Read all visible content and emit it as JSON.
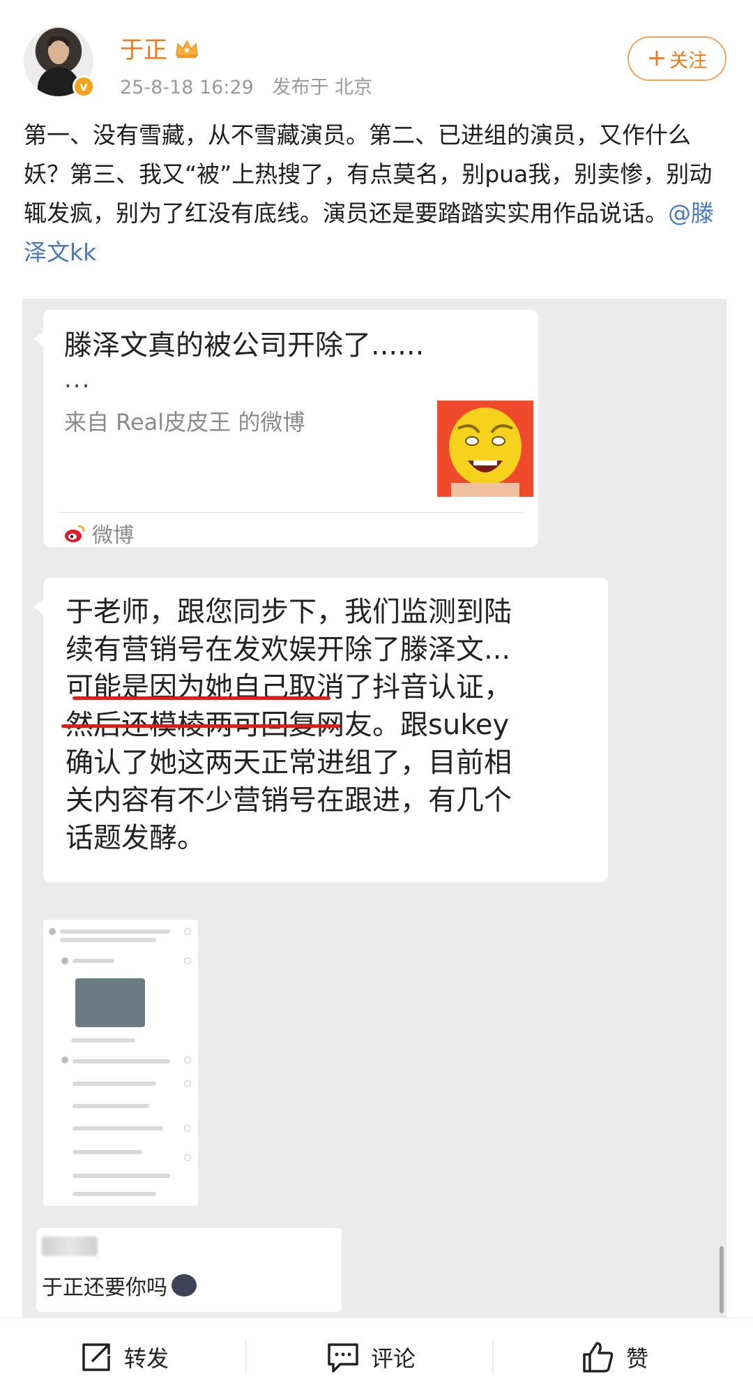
{
  "post": {
    "username": "于正",
    "time": "25-8-18 16:29",
    "location": "发布于 北京",
    "follow_label": "关注",
    "follow_plus": "+",
    "verified_badge": "v",
    "text": "第一、没有雪藏，从不雪藏演员。第二、已进组的演员，又作什么妖？第三、我又“被”上热搜了，有点莫名，别pua我，别卖惨，别动辄发疯，别为了红没有底线。演员还是要踏踏实实用作品说话。",
    "mention": "@滕泽文kk"
  },
  "screenshot": {
    "bubble1": {
      "title": "滕泽文真的被公司开除了......",
      "title_cont": "...",
      "source": "来自 Real皮皮王 的微博",
      "footer": "微博"
    },
    "bubble2": {
      "lines": [
        "于老师，跟您同步下，我们监测到陆",
        "续有营销号在发欢娱开除了滕泽文...",
        "可能是因为她自己取消了抖音认证，",
        "然后还模棱两可回复网友。跟sukey",
        "确认了她这两天正常进组了，目前相",
        "关内容有不少营销号在跟进，有几个",
        "话题发酵。"
      ]
    },
    "bubble3": {
      "text": "于正还要你吗"
    }
  },
  "toolbar": {
    "repost": "转发",
    "comment": "评论",
    "like": "赞"
  },
  "colors": {
    "username": "#f07a1a",
    "mention": "#4b78b8",
    "underline": "#e01b1b",
    "screenshot_bg": "#ebebeb"
  }
}
